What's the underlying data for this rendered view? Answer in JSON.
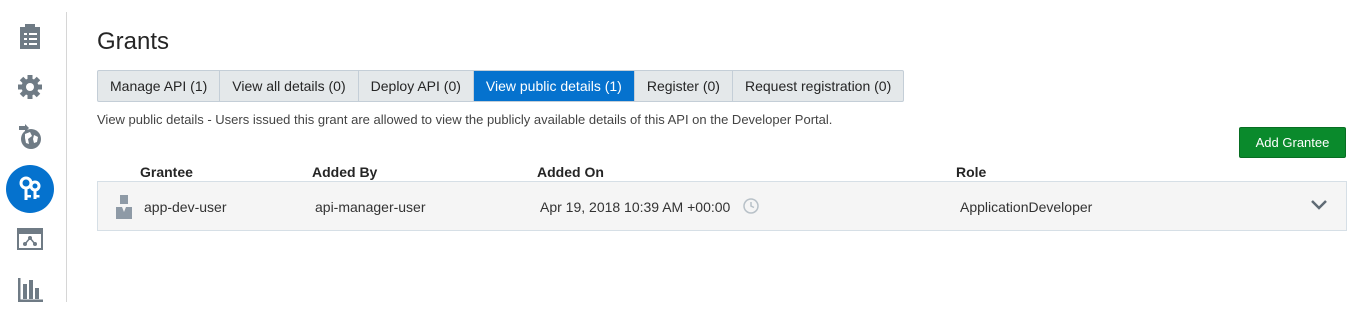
{
  "sidebar": {
    "items": [
      {
        "icon": "document-list-icon",
        "active": false
      },
      {
        "icon": "gear-icon",
        "active": false
      },
      {
        "icon": "globe-deploy-icon",
        "active": false
      },
      {
        "icon": "keys-icon",
        "active": true
      },
      {
        "icon": "portal-icon",
        "active": false
      },
      {
        "icon": "bar-chart-icon",
        "active": false
      }
    ]
  },
  "page": {
    "title": "Grants"
  },
  "tabs": [
    {
      "label": "Manage API (1)",
      "active": false
    },
    {
      "label": "View all details (0)",
      "active": false
    },
    {
      "label": "Deploy API (0)",
      "active": false
    },
    {
      "label": "View public details (1)",
      "active": true
    },
    {
      "label": "Register (0)",
      "active": false
    },
    {
      "label": "Request registration (0)",
      "active": false
    }
  ],
  "description": "View public details - Users issued this grant are allowed to view the publicly available details of this API on the Developer Portal.",
  "actions": {
    "add_grantee": "Add Grantee"
  },
  "table": {
    "columns": [
      "Grantee",
      "Added By",
      "Added On",
      "Role"
    ],
    "rows": [
      {
        "grantee": "app-dev-user",
        "added_by": "api-manager-user",
        "added_on": "Apr 19, 2018 10:39 AM +00:00",
        "role": "ApplicationDeveloper"
      }
    ]
  },
  "colors": {
    "accent": "#0572ce",
    "add_button": "#0a8a2c",
    "sidebar_icon": "#6f7b85"
  }
}
